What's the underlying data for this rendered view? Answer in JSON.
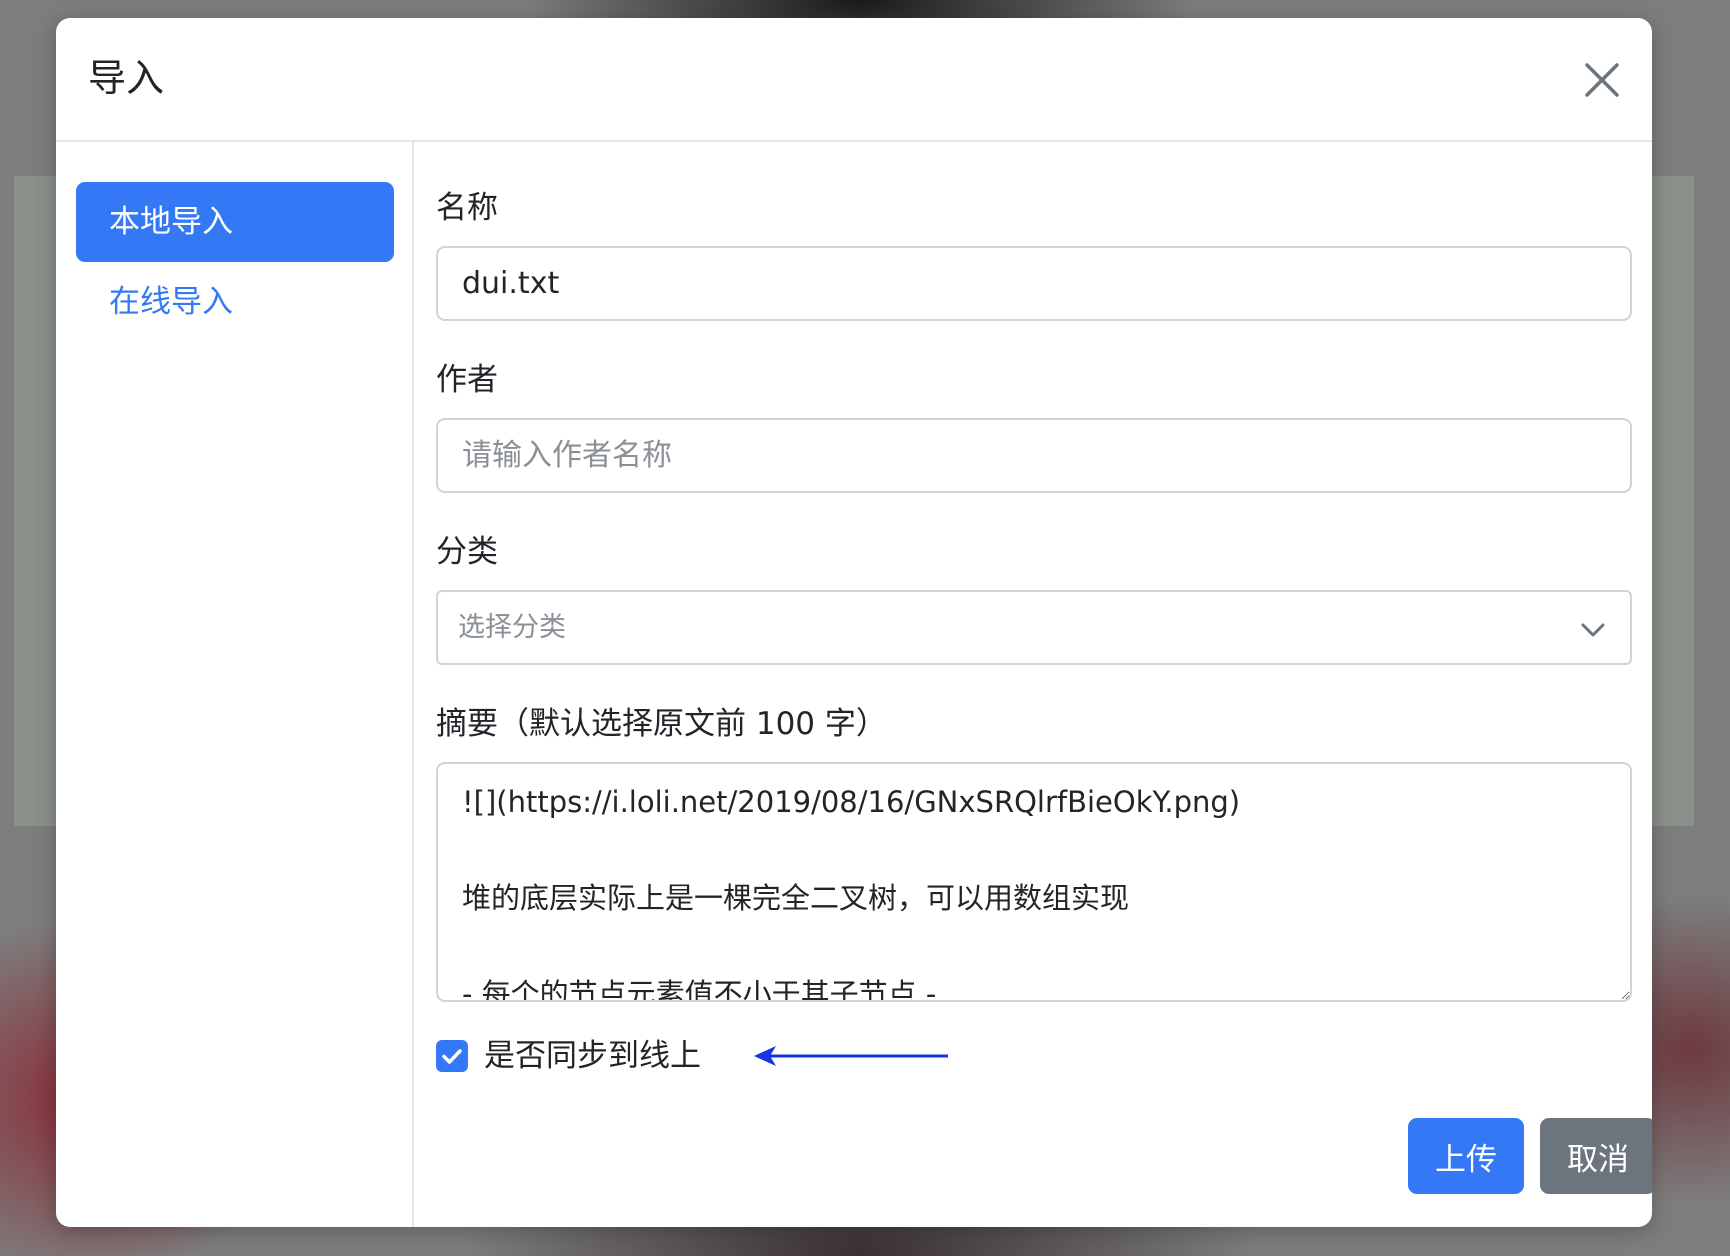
{
  "modal": {
    "title": "导入"
  },
  "sidebar": {
    "items": [
      {
        "label": "本地导入",
        "active": true
      },
      {
        "label": "在线导入",
        "active": false
      }
    ]
  },
  "form": {
    "name": {
      "label": "名称",
      "value": "dui.txt"
    },
    "author": {
      "label": "作者",
      "value": "",
      "placeholder": "请输入作者名称"
    },
    "category": {
      "label": "分类",
      "placeholder": "选择分类"
    },
    "summary": {
      "label": "摘要（默认选择原文前 100 字）",
      "value": "![](https://i.loli.net/2019/08/16/GNxSRQlrfBieOkY.png)\n\n堆的底层实际上是一棵完全二叉树，可以用数组实现\n\n- 每个的节点元素值不小于其子节点 -"
    },
    "sync": {
      "label": "是否同步到线上",
      "checked": true
    }
  },
  "actions": {
    "upload_label": "上传",
    "cancel_label": "取消"
  },
  "colors": {
    "primary": "#3578f6",
    "secondary": "#6c757d",
    "annotation_arrow": "#1535e6"
  },
  "icons": {
    "close": "close-icon",
    "chevron": "chevron-down-icon",
    "check": "check-icon",
    "arrow": "arrow-left-icon"
  }
}
